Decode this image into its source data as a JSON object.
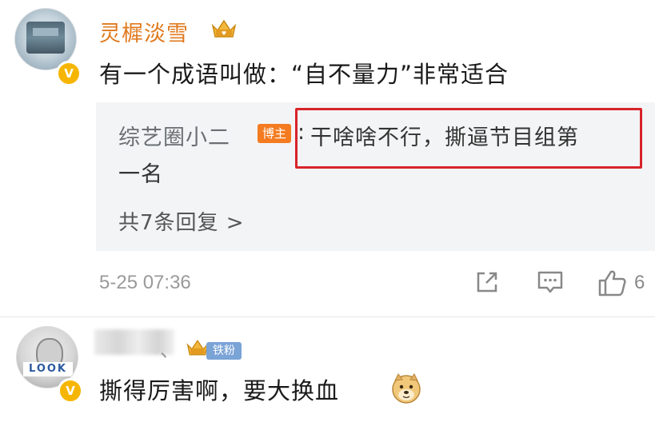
{
  "comments": [
    {
      "username": "灵樨淡雪",
      "verified_badge": "V",
      "text": "有一个成语叫做：“自不量力”非常适合",
      "reply": {
        "author": "综艺圈小二",
        "author_badge": "博主",
        "colon": ":",
        "text_line1": "干啥啥不行，撕逼节目组第",
        "text_line2": "一名",
        "count_label": "共7条回复 >"
      },
      "timestamp": "5-25 07:36",
      "like_count": "6",
      "icons": [
        "share-icon",
        "comment-icon",
        "like-icon",
        "crown-icon"
      ]
    },
    {
      "username_separator": "、",
      "verified_badge": "V",
      "avatar_tag": "LOOK",
      "fan_badge": "铁粉",
      "text": "撕得厉害啊，要大换血",
      "icons": [
        "crown-icon",
        "doge-emoji-icon"
      ]
    }
  ],
  "colors": {
    "username": "#e07a1f",
    "highlight_border": "#d8232a",
    "blogger_badge": "#f47b20",
    "verified_badge": "#f6b600",
    "reply_background": "#f3f4f6",
    "fan_badge": "#7aa3d6"
  }
}
